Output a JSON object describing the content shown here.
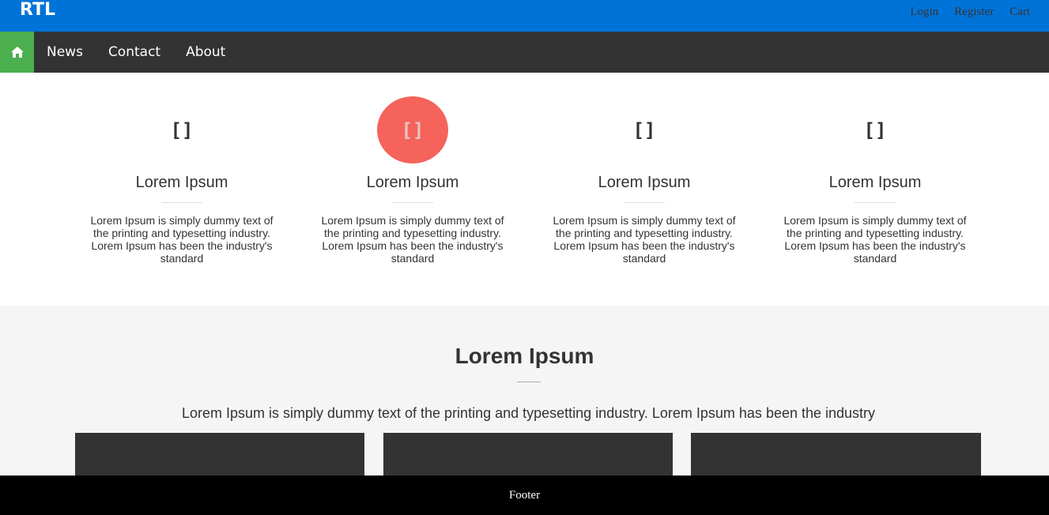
{
  "header": {
    "brand": "RTL",
    "links": [
      "Login",
      "Register",
      "Cart"
    ],
    "accent_color": "#0073d9"
  },
  "nav": {
    "home_icon": "home-icon",
    "home_color": "#4caf50",
    "items": [
      "News",
      "Contact",
      "About"
    ]
  },
  "features": [
    {
      "icon": "[]",
      "title": "Lorem Ipsum",
      "text": "Lorem Ipsum is simply dummy text of the printing and typesetting industry. Lorem Ipsum has been the industry's standard",
      "active": false
    },
    {
      "icon": "[]",
      "title": "Lorem Ipsum",
      "text": "Lorem Ipsum is simply dummy text of the printing and typesetting industry. Lorem Ipsum has been the industry's standard",
      "active": true
    },
    {
      "icon": "[]",
      "title": "Lorem Ipsum",
      "text": "Lorem Ipsum is simply dummy text of the printing and typesetting industry. Lorem Ipsum has been the industry's standard",
      "active": false
    },
    {
      "icon": "[]",
      "title": "Lorem Ipsum",
      "text": "Lorem Ipsum is simply dummy text of the printing and typesetting industry. Lorem Ipsum has been the industry's standard",
      "active": false
    }
  ],
  "section": {
    "title": "Lorem Ipsum",
    "text": "Lorem Ipsum is simply dummy text of the printing and typesetting industry. Lorem Ipsum has been the industry"
  },
  "footer": {
    "text": "Footer"
  }
}
